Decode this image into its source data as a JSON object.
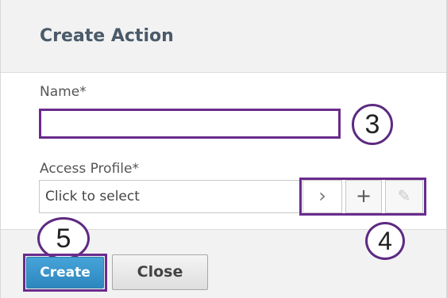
{
  "dialog": {
    "title": "Create Action"
  },
  "form": {
    "name_label": "Name*",
    "name_value": "",
    "access_profile_label": "Access Profile*",
    "access_profile_placeholder": "Click to select",
    "buttons": {
      "select_icon": "chevron-right-icon",
      "select_glyph": "›",
      "add_icon": "plus-icon",
      "add_glyph": "+",
      "edit_icon": "pencil-icon",
      "edit_glyph": "✎"
    }
  },
  "footer": {
    "create_label": "Create",
    "close_label": "Close"
  },
  "callouts": {
    "name": "3",
    "profile_buttons": "4",
    "create": "5"
  },
  "colors": {
    "accent_outline": "#6a2b8d",
    "primary_button": "#2d87bf",
    "header_bg": "#f2f2f2"
  }
}
